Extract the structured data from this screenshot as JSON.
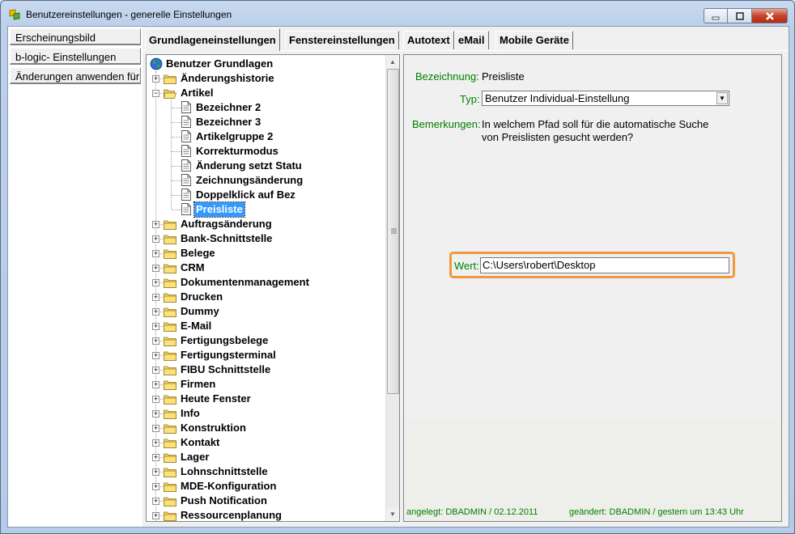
{
  "window": {
    "title": "Benutzereinstellungen - generelle Einstellungen"
  },
  "leftnav": {
    "items": [
      {
        "label": "Erscheinungsbild"
      },
      {
        "label": "b-logic- Einstellungen"
      },
      {
        "label": "Änderungen anwenden für"
      }
    ]
  },
  "tabs": [
    {
      "label": "Grundlageneinstellungen",
      "active": true
    },
    {
      "label": "Fenstereinstellungen"
    },
    {
      "label": "Autotext"
    },
    {
      "label": "eMail"
    },
    {
      "label": "Mobile Geräte"
    }
  ],
  "tree": {
    "root": "Benutzer Grundlagen",
    "items": [
      {
        "label": "Änderungshistorie",
        "type": "folder",
        "level": 1,
        "expanded": false
      },
      {
        "label": "Artikel",
        "type": "folder",
        "level": 1,
        "expanded": true
      },
      {
        "label": "Bezeichner 2",
        "type": "doc",
        "level": 2
      },
      {
        "label": "Bezeichner 3",
        "type": "doc",
        "level": 2
      },
      {
        "label": "Artikelgruppe 2",
        "type": "doc",
        "level": 2
      },
      {
        "label": "Korrekturmodus",
        "type": "doc",
        "level": 2
      },
      {
        "label": "Änderung setzt Statu",
        "type": "doc",
        "level": 2
      },
      {
        "label": "Zeichnungsänderung",
        "type": "doc",
        "level": 2
      },
      {
        "label": "Doppelklick auf Bez",
        "type": "doc",
        "level": 2
      },
      {
        "label": "Preisliste",
        "type": "doc",
        "level": 2,
        "selected": true
      },
      {
        "label": "Auftragsänderung",
        "type": "folder",
        "level": 1
      },
      {
        "label": "Bank-Schnittstelle",
        "type": "folder",
        "level": 1
      },
      {
        "label": "Belege",
        "type": "folder",
        "level": 1
      },
      {
        "label": "CRM",
        "type": "folder",
        "level": 1
      },
      {
        "label": "Dokumentenmanagement",
        "type": "folder",
        "level": 1
      },
      {
        "label": "Drucken",
        "type": "folder",
        "level": 1
      },
      {
        "label": "Dummy",
        "type": "folder",
        "level": 1
      },
      {
        "label": "E-Mail",
        "type": "folder",
        "level": 1
      },
      {
        "label": "Fertigungsbelege",
        "type": "folder",
        "level": 1
      },
      {
        "label": "Fertigungsterminal",
        "type": "folder",
        "level": 1
      },
      {
        "label": "FIBU Schnittstelle",
        "type": "folder",
        "level": 1
      },
      {
        "label": "Firmen",
        "type": "folder",
        "level": 1
      },
      {
        "label": "Heute Fenster",
        "type": "folder",
        "level": 1
      },
      {
        "label": "Info",
        "type": "folder",
        "level": 1
      },
      {
        "label": "Konstruktion",
        "type": "folder",
        "level": 1
      },
      {
        "label": "Kontakt",
        "type": "folder",
        "level": 1
      },
      {
        "label": "Lager",
        "type": "folder",
        "level": 1
      },
      {
        "label": "Lohnschnittstelle",
        "type": "folder",
        "level": 1
      },
      {
        "label": "MDE-Konfiguration",
        "type": "folder",
        "level": 1
      },
      {
        "label": "Push Notification",
        "type": "folder",
        "level": 1
      },
      {
        "label": "Ressourcenplanung",
        "type": "folder",
        "level": 1
      }
    ]
  },
  "detail": {
    "bezeichnung_label": "Bezeichnung:",
    "bezeichnung_value": "Preisliste",
    "typ_label": "Typ:",
    "typ_value": "Benutzer Individual-Einstellung",
    "bemerkungen_label": "Bemerkungen:",
    "bemerkungen_line1": "In welchem Pfad soll für die automatische Suche",
    "bemerkungen_line2": "von Preislisten gesucht werden?",
    "wert_label": "Wert:",
    "wert_value": "C:\\Users\\robert\\Desktop",
    "angelegt": "angelegt: DBADMIN / 02.12.2011",
    "geaendert": "geändert: DBADMIN / gestern um 13:43 Uhr"
  },
  "colors": {
    "label_green": "#008000",
    "highlight_orange": "#f0983c",
    "selection_blue": "#3399ff"
  }
}
